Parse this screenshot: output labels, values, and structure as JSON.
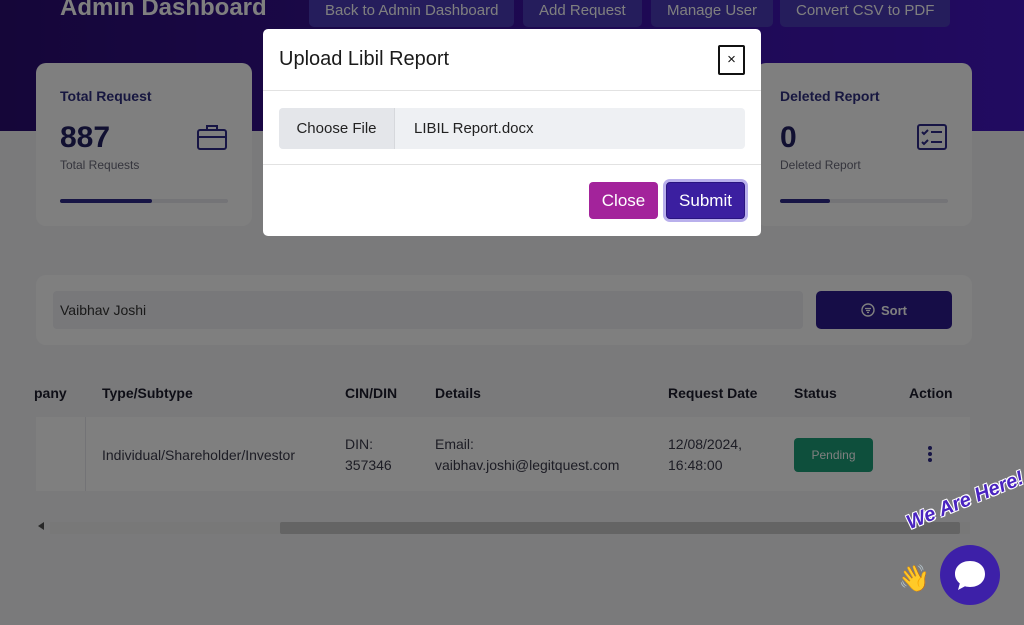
{
  "header": {
    "title": "Admin Dashboard",
    "buttons": [
      "Back to Admin Dashboard",
      "Add Request",
      "Manage User",
      "Convert CSV to PDF"
    ]
  },
  "stats": {
    "total": {
      "title": "Total Request",
      "value": "887",
      "subtitle": "Total Requests",
      "icon": "briefcase-icon",
      "progress": 0.55
    },
    "deleted": {
      "title": "Deleted Report",
      "value": "0",
      "subtitle": "Deleted Report",
      "icon": "checklist-icon",
      "progress": 0.3
    }
  },
  "search": {
    "value": "Vaibhav Joshi",
    "sort_label": "Sort"
  },
  "table": {
    "headers": [
      "pany",
      "Type/Subtype",
      "CIN/DIN",
      "Details",
      "Request Date",
      "Status",
      "Action"
    ],
    "rows": [
      {
        "type": "Individual/Shareholder/Investor",
        "cin_line1": "DIN:",
        "cin_line2": "357346",
        "details_line1": "Email:",
        "details_line2": "vaibhav.joshi@legitquest.com",
        "date_line1": "12/08/2024,",
        "date_line2": "16:48:00",
        "status": "Pending"
      }
    ]
  },
  "modal": {
    "title": "Upload Libil Report",
    "close_x": "×",
    "choose_file": "Choose File",
    "file_name": "LIBIL Report.docx",
    "close_label": "Close",
    "submit_label": "Submit"
  },
  "chat": {
    "label": "We Are Here!"
  },
  "colors": {
    "accent": "#3b1fa0",
    "close": "#a3239b",
    "pending": "#1c9e78",
    "hero": "#3c12a4"
  }
}
